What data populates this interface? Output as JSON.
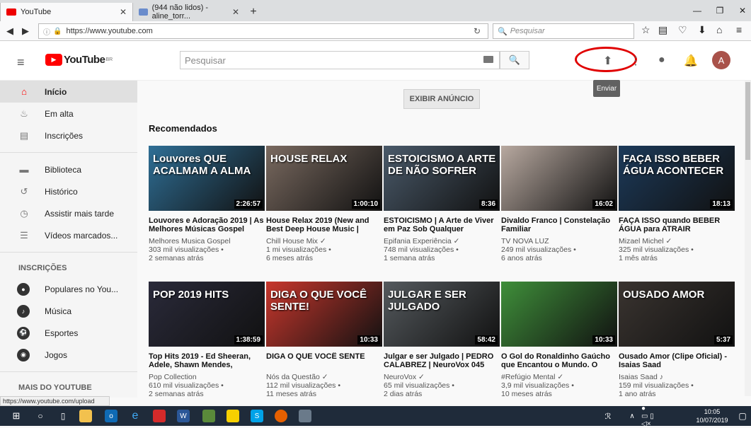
{
  "browser": {
    "tabs": [
      {
        "label": "YouTube",
        "active": true
      },
      {
        "label": "(944 não lidos) - aline_torr...",
        "active": false
      }
    ],
    "url": "https://www.youtube.com",
    "search_placeholder": "Pesquisar",
    "status_url": "https://www.youtube.com/upload"
  },
  "header": {
    "logo_text": "YouTube",
    "logo_region": "BR",
    "search_placeholder": "Pesquisar",
    "avatar_letter": "A",
    "upload_tooltip": "Enviar"
  },
  "sidebar": {
    "main": [
      {
        "label": "Início",
        "icon": "home-icon",
        "active": true
      },
      {
        "label": "Em alta",
        "icon": "flame-icon"
      },
      {
        "label": "Inscrições",
        "icon": "subscriptions-icon"
      }
    ],
    "library": [
      {
        "label": "Biblioteca",
        "icon": "folder-icon"
      },
      {
        "label": "Histórico",
        "icon": "history-icon"
      },
      {
        "label": "Assistir mais tarde",
        "icon": "clock-icon"
      },
      {
        "label": "Vídeos marcados...",
        "icon": "playlist-icon"
      }
    ],
    "subs_heading": "INSCRIÇÕES",
    "subs": [
      {
        "label": "Populares no You..."
      },
      {
        "label": "Música"
      },
      {
        "label": "Esportes"
      },
      {
        "label": "Jogos"
      }
    ],
    "more_heading": "MAIS DO YOUTUBE"
  },
  "main": {
    "ad_button": "EXIBIR ANÚNCIO",
    "section_title": "Recomendados",
    "videos": [
      {
        "title": "Louvores e Adoração 2019 | As Melhores Músicas Gospel",
        "channel": "Melhores Musica Gospel",
        "views": "303 mil visualizações •",
        "age": "2 semanas atrás",
        "duration": "2:26:57",
        "thumb_text": "Louvores QUE ACALMAM A ALMA",
        "color": "#2f6f96"
      },
      {
        "title": "House Relax 2019 (New and Best Deep House Music |",
        "channel": "Chill House Mix ✓",
        "views": "1 mi visualizações •",
        "age": "6 meses atrás",
        "duration": "1:00:10",
        "thumb_text": "HOUSE RELAX",
        "color": "#7a6a60"
      },
      {
        "title": "ESTOICISMO | A Arte de Viver em Paz Sob Qualquer",
        "channel": "Epifania Experiência ✓",
        "views": "748 mil visualizações •",
        "age": "1 semana atrás",
        "duration": "8:36",
        "thumb_text": "ESTOICISMO A ARTE DE NÃO SOFRER",
        "color": "#4a5a6a"
      },
      {
        "title": "Divaldo Franco | Constelação Familiar",
        "channel": "TV NOVA LUZ",
        "views": "249 mil visualizações •",
        "age": "6 anos atrás",
        "duration": "16:02",
        "thumb_text": "",
        "color": "#b8a9a0"
      },
      {
        "title": "FAÇA ISSO quando BEBER ÁGUA para ATRAIR",
        "channel": "Mizael Michel ✓",
        "views": "325 mil visualizações •",
        "age": "1 mês atrás",
        "duration": "18:13",
        "thumb_text": "FAÇA ISSO BEBER ÁGUA ACONTECER",
        "color": "#1c3a5a"
      },
      {
        "title": "Top Hits 2019 - Ed Sheeran, Adele, Shawn Mendes,",
        "channel": "Pop Collection",
        "views": "610 mil visualizações •",
        "age": "2 semanas atrás",
        "duration": "1:38:59",
        "thumb_text": "POP 2019 HITS",
        "color": "#2a2a3a"
      },
      {
        "title": "DIGA O QUE VOCÊ SENTE",
        "channel": "Nós da Questão ✓",
        "views": "112 mil visualizações •",
        "age": "11 meses atrás",
        "duration": "10:33",
        "thumb_text": "DIGA O QUE VOCÊ SENTE!",
        "color": "#c8372d"
      },
      {
        "title": "Julgar e ser Julgado | PEDRO CALABREZ | NeuroVox 045",
        "channel": "NeuroVox ✓",
        "views": "65 mil visualizações •",
        "age": "2 dias atrás",
        "duration": "58:42",
        "thumb_text": "JULGAR E SER JULGADO",
        "color": "#555a5e"
      },
      {
        "title": "O Gol do Ronaldinho Gaúcho que Encantou o Mundo. O",
        "channel": "#Refúgio Mental ✓",
        "views": "3,9 mil visualizações •",
        "age": "10 meses atrás",
        "duration": "10:33",
        "thumb_text": "",
        "color": "#3f8f3a"
      },
      {
        "title": "Ousado Amor (Clipe Oficial) - Isaias Saad",
        "channel": "Isaias Saad ♪",
        "views": "159 mil visualizações •",
        "age": "1 ano atrás",
        "duration": "5:37",
        "thumb_text": "OUSADO AMOR",
        "color": "#3a3430"
      }
    ]
  },
  "taskbar": {
    "time": "10:05",
    "date": "10/07/2019"
  }
}
